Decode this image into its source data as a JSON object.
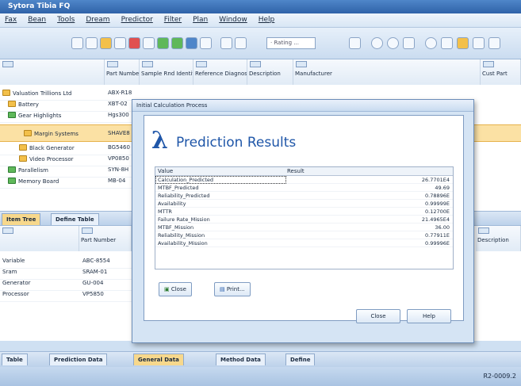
{
  "app": {
    "title": "Sytora Tibia FQ"
  },
  "menu": [
    "Fax",
    "Bean",
    "Tools",
    "Dream",
    "Predictor",
    "Filter",
    "Plan",
    "Window",
    "Help"
  ],
  "toolbar": {
    "search_text": "· Rating ..."
  },
  "upper": {
    "columns": [
      "",
      "",
      "Part Number",
      "Sample Rnd Identifier",
      "Reference Diagnostics",
      "Description",
      "Manufacturer",
      "",
      "Cust Part"
    ],
    "rows": [
      {
        "label": "Valuation Trillions Ltd",
        "part": "ABX-R18",
        "icon": "folder"
      },
      {
        "label": "Battery",
        "part": "XBT-02",
        "icon": "folder"
      },
      {
        "label": "Gear Highlights",
        "part": "Hgs300",
        "icon": "green"
      },
      {
        "label": "Margin Systems",
        "part": "SHAVE8",
        "icon": "folder"
      },
      {
        "label": "Black Generator",
        "part": "BG5460",
        "icon": "folder"
      },
      {
        "label": "Video Processor",
        "part": "VP0850",
        "icon": "folder"
      },
      {
        "label": "Parallelism",
        "part": "SYN-8H",
        "icon": "green"
      },
      {
        "label": "Memory Board",
        "part": "MB-04",
        "icon": "green"
      }
    ]
  },
  "mid_tabs": [
    "Item Tree",
    "Define Table"
  ],
  "lower": {
    "columns": [
      "",
      "",
      "Part Number",
      "",
      "Description"
    ],
    "rows": [
      {
        "label": "Variable",
        "part": "ABC-8554"
      },
      {
        "label": "Sram",
        "part": "SRAM-01"
      },
      {
        "label": "Generator",
        "part": "GU-004"
      },
      {
        "label": "Processor",
        "part": "VP5850"
      }
    ]
  },
  "bottom_tabs": [
    "Table",
    "Prediction Data",
    "General Data",
    "Method Data",
    "Define"
  ],
  "status": {
    "right_text": "R2-0009.2"
  },
  "outer_dialog": {
    "title": "Initial Calculation Process"
  },
  "prediction": {
    "title": "Prediction Results",
    "col_value": "Value",
    "col_result": "Result",
    "rows": [
      {
        "name": "Calculation_Predicted",
        "value": "26.7701E4"
      },
      {
        "name": "MTBF_Predicted",
        "value": "49.69"
      },
      {
        "name": "Reliability_Predicted",
        "value": "0.78896E"
      },
      {
        "name": "Availability",
        "value": "0.99999E"
      },
      {
        "name": "MTTR",
        "value": "0.12700E"
      },
      {
        "name": "Failure Rate_Mission",
        "value": "21.4965E4"
      },
      {
        "name": "MTBF_Mission",
        "value": "36.00"
      },
      {
        "name": "Reliability_Mission",
        "value": "0.77911E"
      },
      {
        "name": "Availability_Mission",
        "value": "0.99996E"
      }
    ],
    "buttons": {
      "close": "Close",
      "print": "Print...",
      "ok": "Close",
      "help": "Help"
    }
  }
}
